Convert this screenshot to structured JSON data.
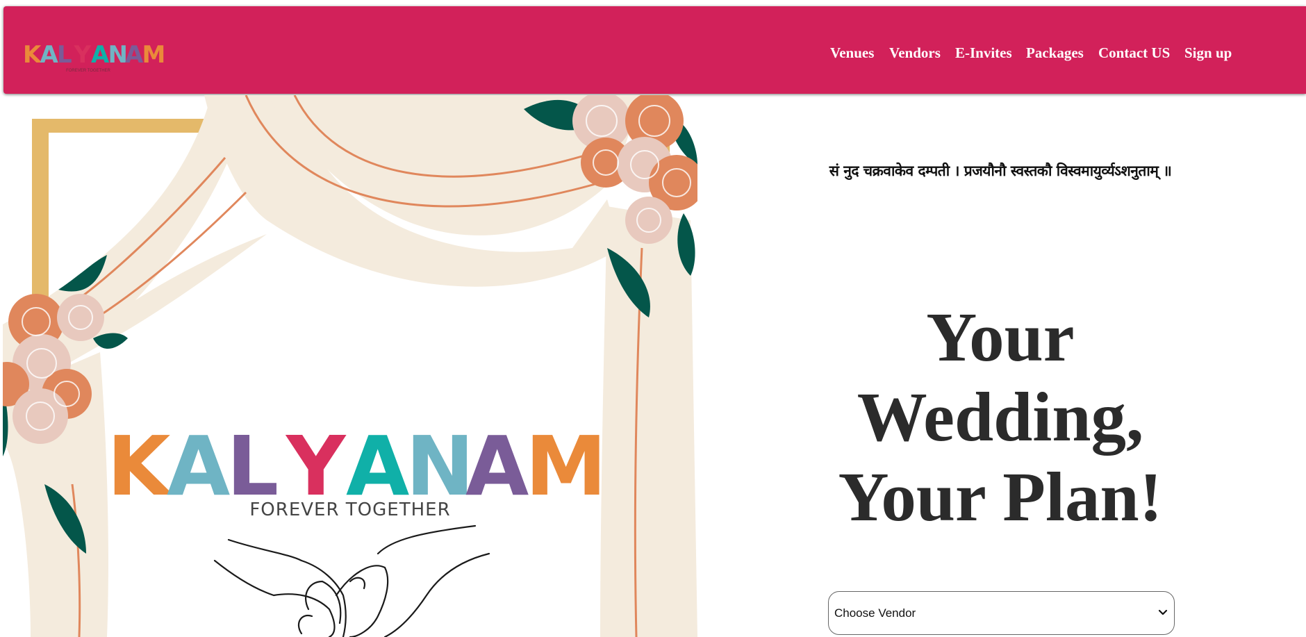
{
  "brand": {
    "logo_text": "KALYANAM",
    "logo_tagline": "FOREVER TOGETHER",
    "colors": {
      "nav_bg": "#d2215a",
      "nav_text": "#ffffff",
      "logo_red": "#d9305e",
      "logo_orange": "#ea8a3a",
      "logo_teal": "#6fb4c4",
      "logo_purple": "#7a5c98",
      "logo_cyan": "#10b0a8",
      "frame_gold": "#e4b96a",
      "drape_cream": "#f4ebdd",
      "leaf_green": "#04564a",
      "rose_orange": "#e0875c",
      "rose_pink": "#e8c9be"
    }
  },
  "nav": {
    "items": [
      {
        "label": "Venues"
      },
      {
        "label": "Vendors"
      },
      {
        "label": "E-Invites"
      },
      {
        "label": "Packages"
      },
      {
        "label": "Contact US"
      },
      {
        "label": "Sign up"
      }
    ]
  },
  "hero": {
    "shloka": "सं नुद चक्रवाकेव दम्पती । प्रजयौनौ स्वस्तकौ विस्वमायुर्व्यऽशनुताम् ॥",
    "title_lines": [
      "Your",
      "Wedding,",
      "Your Plan!"
    ],
    "vendor_select": {
      "selected": "Choose Vendor"
    },
    "illustration": {
      "logo_text": "KALYANAM",
      "tagline": "FOREVER TOGETHER",
      "icons": [
        "heart-hands-icon",
        "rose-cluster-icon"
      ]
    }
  }
}
